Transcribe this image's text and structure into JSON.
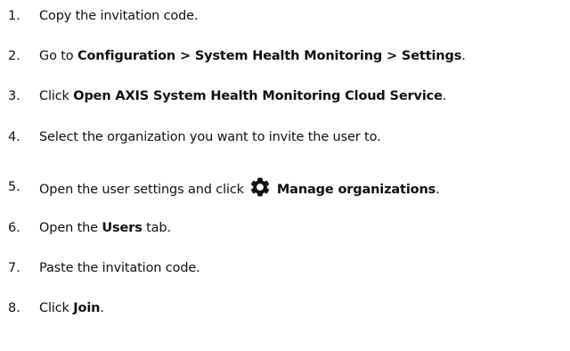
{
  "steps": [
    {
      "num": "1.",
      "t1": "Copy the invitation code."
    },
    {
      "num": "2.",
      "t1": "Go to ",
      "b1": "Configuration > System Health Monitoring > Settings",
      "t2": "."
    },
    {
      "num": "3.",
      "t1": "Click ",
      "b1": "Open AXIS System Health Monitoring Cloud Service",
      "t2": "."
    },
    {
      "num": "4.",
      "t1": "Select the organization you want to invite the user to."
    },
    {
      "num": "5.",
      "t1": "Open the user settings and click",
      "icon": "gear-icon",
      "b1": "Manage organizations",
      "t2": "."
    },
    {
      "num": "6.",
      "t1": "Open the ",
      "b1": "Users",
      "t2": " tab."
    },
    {
      "num": "7.",
      "t1": "Paste the invitation code."
    },
    {
      "num": "8.",
      "t1": "Click ",
      "b1": "Join",
      "t2": "."
    }
  ]
}
